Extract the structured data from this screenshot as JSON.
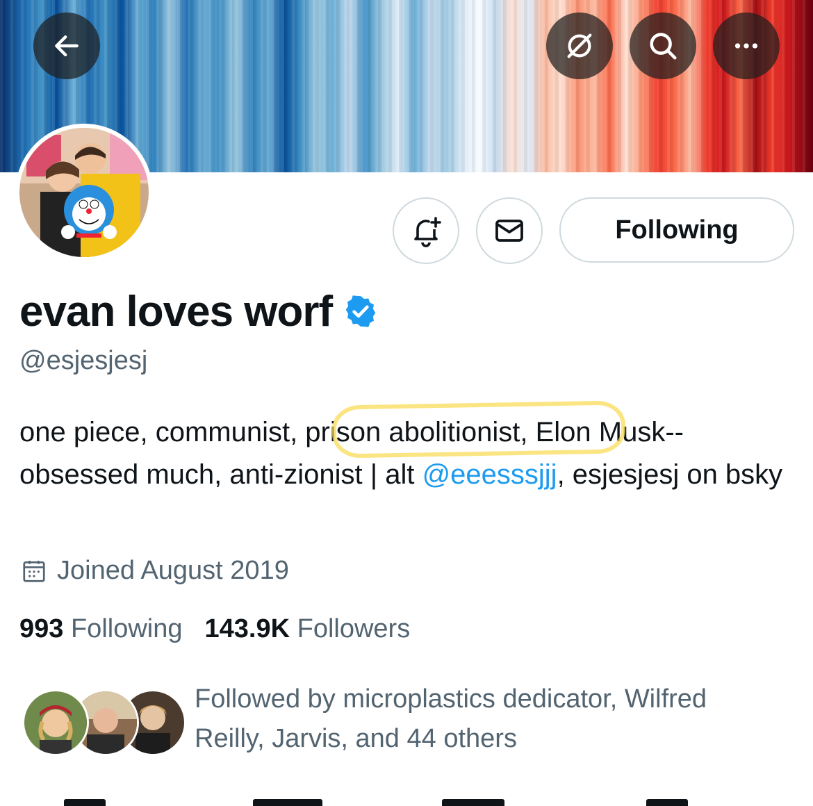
{
  "header": {
    "back_icon": "arrow-left-icon",
    "grok_icon": "grok-icon",
    "search_icon": "search-icon",
    "more_icon": "more-horizontal-icon"
  },
  "profile": {
    "display_name": "evan loves worf",
    "verified": true,
    "verified_color": "#1d9bf0",
    "handle": "@esjesjesj",
    "bio_part1": "one piece, communist, prison abolitionist, Elon Musk--obsessed much, anti-zionist | alt ",
    "bio_mention": "@eeesssjjj",
    "bio_part2": ", esjesjesj on bsky",
    "joined": "Joined August 2019",
    "following_count": "993",
    "following_label": "Following",
    "followers_count": "143.9K",
    "followers_label": "Followers",
    "followed_by": "Followed by microplastics dedicator, Wilfred Reilly, Jarvis, and 44 others"
  },
  "actions": {
    "notify_icon": "bell-plus-icon",
    "message_icon": "envelope-icon",
    "following_button": "Following"
  },
  "colors": {
    "text_primary": "#0f1419",
    "text_secondary": "#536471",
    "link": "#1d9bf0",
    "border": "#cfd9de",
    "highlight": "#fadc5a"
  }
}
